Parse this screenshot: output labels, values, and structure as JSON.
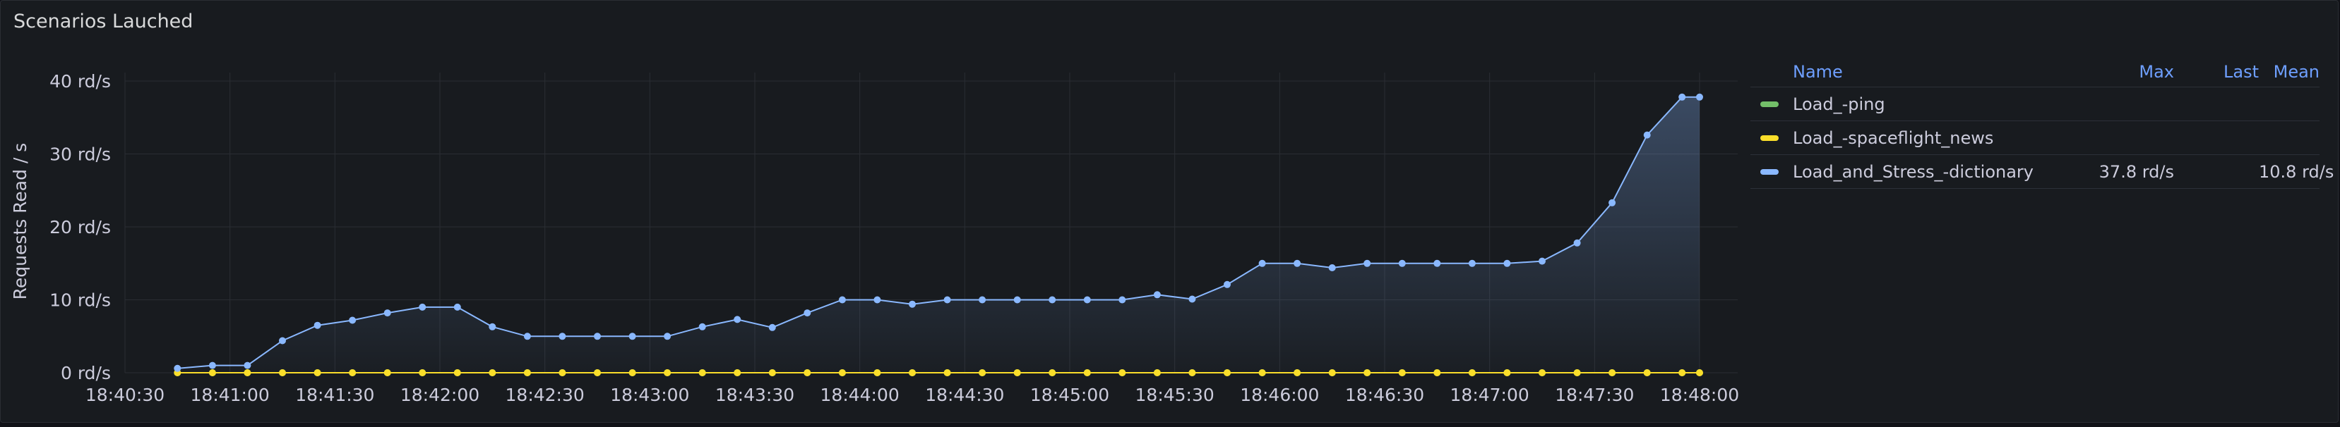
{
  "panel": {
    "title": "Scenarios Lauched"
  },
  "legend": {
    "headers": {
      "name": "Name",
      "max": "Max",
      "last": "Last",
      "mean": "Mean"
    },
    "rows": [
      {
        "name": "Load_-ping",
        "color": "#73bf69",
        "max": "",
        "last": "",
        "mean": ""
      },
      {
        "name": "Load_-spaceflight_news",
        "color": "#fade2a",
        "max": "",
        "last": "",
        "mean": ""
      },
      {
        "name": "Load_and_Stress_-dictionary",
        "color": "#8ab8ff",
        "max": "37.8 rd/s",
        "last": "",
        "mean": "10.8 rd/s"
      }
    ]
  },
  "chart_data": {
    "type": "line",
    "ylabel": "Requests Read / s",
    "yunit": "rd/s",
    "ylim": [
      0,
      40
    ],
    "yticks": [
      0,
      10,
      20,
      30,
      40
    ],
    "ytick_labels": [
      "0 rd/s",
      "10 rd/s",
      "20 rd/s",
      "30 rd/s",
      "40 rd/s"
    ],
    "xlim": [
      "18:40:30",
      "18:48:00"
    ],
    "xtick_labels": [
      "18:40:30",
      "18:41:00",
      "18:41:30",
      "18:42:00",
      "18:42:30",
      "18:43:00",
      "18:43:30",
      "18:44:00",
      "18:44:30",
      "18:45:00",
      "18:45:30",
      "18:46:00",
      "18:46:30",
      "18:47:00",
      "18:47:30",
      "18:48:00"
    ],
    "grid": true,
    "legend_position": "right",
    "x": [
      "18:40:45",
      "18:40:55",
      "18:41:05",
      "18:41:15",
      "18:41:25",
      "18:41:35",
      "18:41:45",
      "18:41:55",
      "18:42:05",
      "18:42:15",
      "18:42:25",
      "18:42:35",
      "18:42:45",
      "18:42:55",
      "18:43:05",
      "18:43:15",
      "18:43:25",
      "18:43:35",
      "18:43:45",
      "18:43:55",
      "18:44:05",
      "18:44:15",
      "18:44:25",
      "18:44:35",
      "18:44:45",
      "18:44:55",
      "18:45:05",
      "18:45:15",
      "18:45:25",
      "18:45:35",
      "18:45:45",
      "18:45:55",
      "18:46:05",
      "18:46:15",
      "18:46:25",
      "18:46:35",
      "18:46:45",
      "18:46:55",
      "18:47:05",
      "18:47:15",
      "18:47:25",
      "18:47:35",
      "18:47:45",
      "18:47:55",
      "18:48:00"
    ],
    "series": [
      {
        "name": "Load_-ping",
        "color": "#73bf69",
        "fill": false,
        "values": [
          0,
          0,
          0,
          0,
          0,
          0,
          0,
          0,
          0,
          0,
          0,
          0,
          0,
          0,
          0,
          0,
          0,
          0,
          0,
          0,
          0,
          0,
          0,
          0,
          0,
          0,
          0,
          0,
          0,
          0,
          0,
          0,
          0,
          0,
          0,
          0,
          0,
          0,
          0,
          0,
          0,
          0,
          0,
          0,
          0
        ]
      },
      {
        "name": "Load_-spaceflight_news",
        "color": "#fade2a",
        "fill": false,
        "values": [
          0,
          0,
          0,
          0,
          0,
          0,
          0,
          0,
          0,
          0,
          0,
          0,
          0,
          0,
          0,
          0,
          0,
          0,
          0,
          0,
          0,
          0,
          0,
          0,
          0,
          0,
          0,
          0,
          0,
          0,
          0,
          0,
          0,
          0,
          0,
          0,
          0,
          0,
          0,
          0,
          0,
          0,
          0,
          0,
          0
        ]
      },
      {
        "name": "Load_and_Stress_-dictionary",
        "color": "#8ab8ff",
        "fill": true,
        "values": [
          0.6,
          1.0,
          1.0,
          4.4,
          6.5,
          7.2,
          8.2,
          9.0,
          9.0,
          6.3,
          5.0,
          5.0,
          5.0,
          5.0,
          5.0,
          6.3,
          7.3,
          6.2,
          8.2,
          10.0,
          10.0,
          9.4,
          10.0,
          10.0,
          10.0,
          10.0,
          10.0,
          10.0,
          10.7,
          10.1,
          12.1,
          15.0,
          15.0,
          14.4,
          15.0,
          15.0,
          15.0,
          15.0,
          15.0,
          15.3,
          17.8,
          23.3,
          32.6,
          37.8,
          37.8
        ]
      }
    ]
  }
}
